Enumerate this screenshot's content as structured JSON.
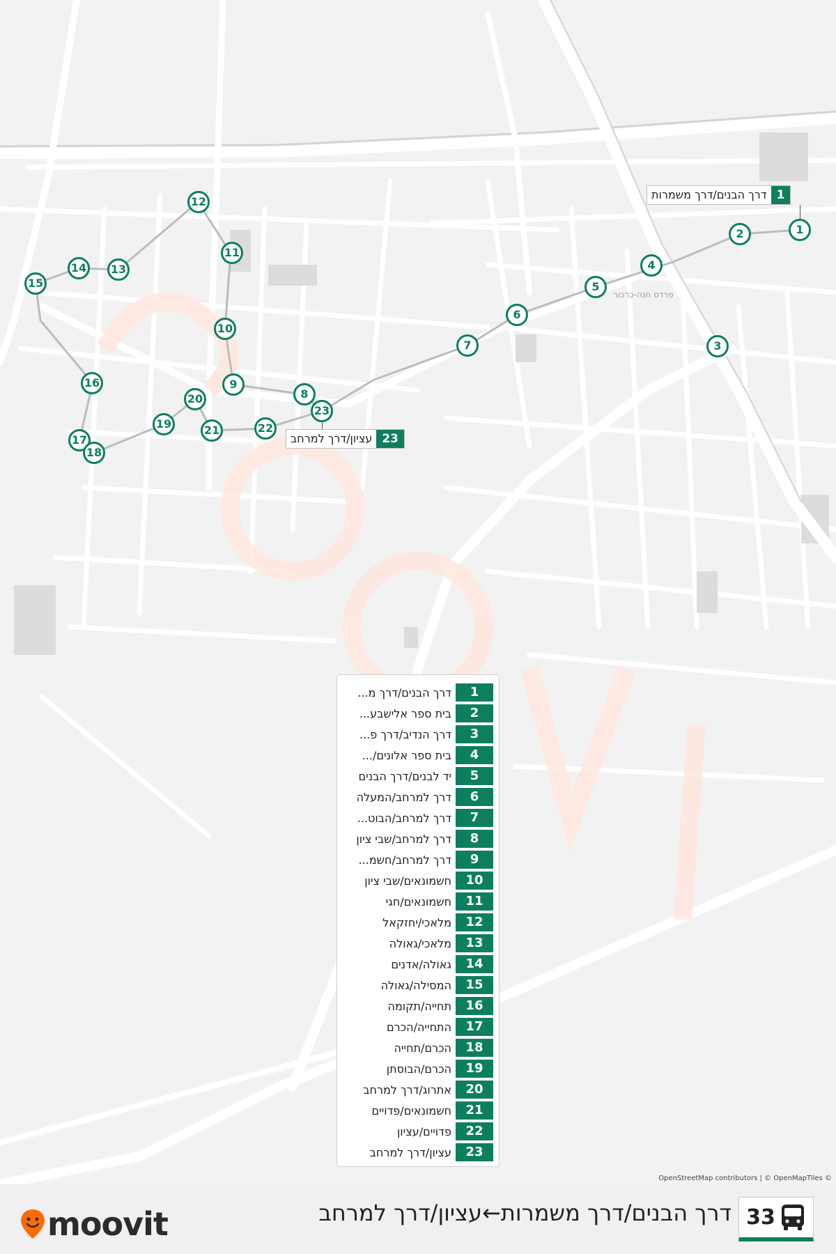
{
  "route": {
    "number": "33",
    "title": "דרך הבנים/דרך משמרות←עציון/דרך למרחב",
    "icon": "bus-icon"
  },
  "brand": {
    "name": "moovit",
    "icon": "map-pin-face-icon",
    "accent": "#ff6b00"
  },
  "colors": {
    "route": "#0d7f5f"
  },
  "attribution": "OpenStreetMap contributors | © OpenMapTiles ©",
  "callouts": {
    "start": {
      "number": "1",
      "label": "דרך הבנים/דרך משמרות"
    },
    "end": {
      "number": "23",
      "label": "עציון/דרך למרחב"
    }
  },
  "map_labels": {
    "area": "פרדס חנה-כרכור"
  },
  "stops": [
    {
      "number": "1",
      "name": "דרך הבנים/דרך מ..."
    },
    {
      "number": "2",
      "name": "בית ספר אלישבע..."
    },
    {
      "number": "3",
      "name": "דרך הנדיב/דרך פ..."
    },
    {
      "number": "4",
      "name": "בית ספר אלונים/..."
    },
    {
      "number": "5",
      "name": "יד לבנים/דרך הבנים"
    },
    {
      "number": "6",
      "name": "דרך למרחב/המעלה"
    },
    {
      "number": "7",
      "name": "דרך למרחב/הבוט..."
    },
    {
      "number": "8",
      "name": "דרך למרחב/שבי ציון"
    },
    {
      "number": "9",
      "name": "דרך למרחב/חשמ..."
    },
    {
      "number": "10",
      "name": "חשמונאים/שבי ציון"
    },
    {
      "number": "11",
      "name": "חשמונאים/חגי"
    },
    {
      "number": "12",
      "name": "מלאכי/יחזקאל"
    },
    {
      "number": "13",
      "name": "מלאכי/גאולה"
    },
    {
      "number": "14",
      "name": "גאולה/אדנים"
    },
    {
      "number": "15",
      "name": "המסילה/גאולה"
    },
    {
      "number": "16",
      "name": "תחייה/תקומה"
    },
    {
      "number": "17",
      "name": "התחייה/הכרם"
    },
    {
      "number": "18",
      "name": "הכרם/תחייה"
    },
    {
      "number": "19",
      "name": "הכרם/הבוסתן"
    },
    {
      "number": "20",
      "name": "אתרוג/דרך למרחב"
    },
    {
      "number": "21",
      "name": "חשמונאים/פדויים"
    },
    {
      "number": "22",
      "name": "פדויים/עציון"
    },
    {
      "number": "23",
      "name": "עציון/דרך למרחב"
    }
  ]
}
